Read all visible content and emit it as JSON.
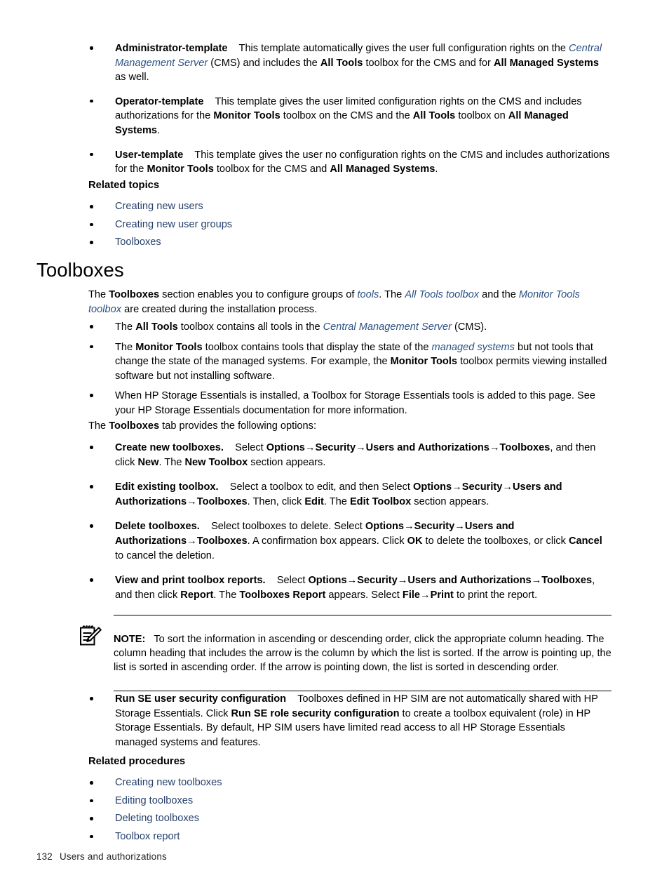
{
  "page": {
    "footer_page_number": "132",
    "footer_chapter": "Users and authorizations"
  },
  "colors": {
    "link": "#27416b",
    "link_italic": "#2b5083",
    "text": "#000000"
  },
  "templates_list": {
    "items": [
      {
        "term": "Administrator-template",
        "segments": [
          {
            "text": "This template automatically gives the user full configuration rights on the ",
            "style": "plain"
          },
          {
            "text": "Central Management Server",
            "style": "link-italic"
          },
          {
            "text": " (CMS) and includes the ",
            "style": "plain"
          },
          {
            "text": "All Tools",
            "style": "bold"
          },
          {
            "text": " toolbox for the CMS and for ",
            "style": "plain"
          },
          {
            "text": "All Managed Systems",
            "style": "bold"
          },
          {
            "text": " as well.",
            "style": "plain"
          }
        ]
      },
      {
        "term": "Operator-template",
        "segments": [
          {
            "text": "This template gives the user limited configuration rights on the CMS and includes authorizations for the ",
            "style": "plain"
          },
          {
            "text": "Monitor Tools",
            "style": "bold"
          },
          {
            "text": " toolbox on the CMS and the ",
            "style": "plain"
          },
          {
            "text": "All Tools",
            "style": "bold"
          },
          {
            "text": " toolbox on ",
            "style": "plain"
          },
          {
            "text": "All Managed Systems",
            "style": "bold"
          },
          {
            "text": ".",
            "style": "plain"
          }
        ]
      },
      {
        "term": "User-template",
        "segments": [
          {
            "text": "This template gives the user no configuration rights on the CMS and includes authorizations for the ",
            "style": "plain"
          },
          {
            "text": "Monitor Tools",
            "style": "bold"
          },
          {
            "text": " toolbox for the CMS and ",
            "style": "plain"
          },
          {
            "text": "All Managed Systems",
            "style": "bold"
          },
          {
            "text": ".",
            "style": "plain"
          }
        ]
      }
    ]
  },
  "related_topics": {
    "heading": "Related topics",
    "links": [
      "Creating new users",
      "Creating new user groups",
      "Toolboxes"
    ]
  },
  "toolboxes_section": {
    "heading": "Toolboxes",
    "intro": {
      "s1": "The ",
      "s2": "Toolboxes",
      "s3": " section enables you to configure groups of ",
      "s4": "tools",
      "s5": ". The ",
      "s6": "All Tools toolbox",
      "s7": " and the ",
      "s8": "Monitor Tools toolbox",
      "s9": " are created during the installation process."
    },
    "bullets": [
      {
        "id": "all-tools",
        "s1": "The ",
        "s2": "All Tools",
        "s3": " toolbox contains all tools in the ",
        "s4": "Central Management Server",
        "s5": " (CMS)."
      },
      {
        "id": "monitor-tools",
        "s1": "The ",
        "s2": "Monitor Tools",
        "s3": " toolbox contains tools that display the state of the ",
        "s4": "managed systems",
        "s5": " but not tools that change the state of the managed systems. For example, the ",
        "s6": "Monitor Tools",
        "s7": " toolbox permits viewing installed software but not installing software."
      },
      {
        "id": "storage-essentials",
        "s1": "When HP Storage Essentials is installed, a Toolbox for Storage Essentials tools is added to this page. See your HP Storage Essentials documentation for more information."
      }
    ],
    "tab_intro": {
      "s1": "The ",
      "s2": "Toolboxes",
      "s3": " tab provides the following options:"
    },
    "options": [
      {
        "id": "create-new-toolboxes",
        "term": "Create new toolboxes.",
        "p1": "Select ",
        "b1": "Options",
        "a1": "→",
        "b2": "Security",
        "a2": "→",
        "b3": "Users and Authorizations",
        "a3": "→",
        "b4": "Toolboxes",
        "p2": ", and then click ",
        "b5": "New",
        "p3": ". The ",
        "b6": "New Toolbox",
        "p4": " section appears."
      },
      {
        "id": "edit-existing-toolbox",
        "term": "Edit existing toolbox.",
        "p1": "Select a toolbox to edit, and then Select ",
        "b1": "Options",
        "a1": "→",
        "b2": "Security",
        "a2": "→",
        "b3": "Users and Authorizations",
        "a3": "→",
        "b4": "Toolboxes",
        "p2": ". Then, click ",
        "b5": "Edit",
        "p3": ". The ",
        "b6": "Edit Toolbox",
        "p4": " section appears."
      },
      {
        "id": "delete-toolboxes",
        "term": "Delete toolboxes.",
        "p1": "Select toolboxes to delete. Select ",
        "b1": "Options",
        "a1": "→",
        "b2": "Security",
        "a2": "→",
        "b3": "Users and Authorizations",
        "a3": "→",
        "b4": "Toolboxes",
        "p2": ". A confirmation box appears. Click ",
        "b5": "OK",
        "p3": " to delete the toolboxes, or click ",
        "b6": "Cancel",
        "p4": " to cancel the deletion."
      },
      {
        "id": "view-print-toolbox-reports",
        "term": "View and print toolbox reports.",
        "p1": "Select ",
        "b1": "Options",
        "a1": "→",
        "b2": "Security",
        "a2": "→",
        "b3": "Users and Authorizations",
        "a3": "→",
        "b4": "Toolboxes",
        "p2": ", and then click ",
        "b5": "Report",
        "p3": ". The ",
        "b6": "Toolboxes Report",
        "p4": " appears. Select ",
        "b7": "File",
        "a4": "→",
        "b8": "Print",
        "p5": " to print the report."
      }
    ],
    "note": {
      "label": "NOTE:",
      "icon": "note-pencil-icon",
      "text": "To sort the information in ascending or descending order, click the appropriate column heading. The column heading that includes the arrow is the column by which the list is sorted. If the arrow is pointing up, the list is sorted in ascending order. If the arrow is pointing down, the list is sorted in descending order."
    },
    "se_bullet": {
      "term": "Run SE user security configuration",
      "p1": "Toolboxes defined in HP SIM are not automatically shared with HP Storage Essentials. Click ",
      "b1": "Run SE role security configuration",
      "p2": " to create a toolbox equivalent (role) in HP Storage Essentials. By default, HP SIM users have limited read access to all HP Storage Essentials managed systems and features."
    }
  },
  "related_procedures": {
    "heading": "Related procedures",
    "links": [
      "Creating new toolboxes",
      "Editing toolboxes",
      "Deleting toolboxes",
      "Toolbox report"
    ]
  }
}
